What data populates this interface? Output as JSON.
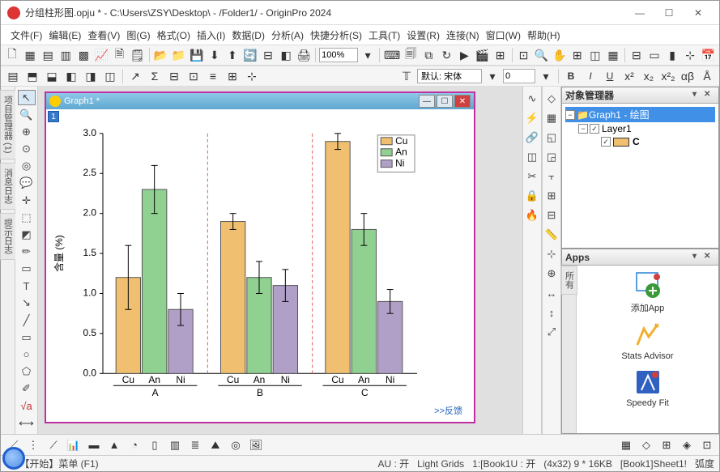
{
  "title": "分组柱形图.opju * - C:\\Users\\ZSY\\Desktop\\ - /Folder1/ - OriginPro 2024",
  "menu": {
    "file": "文件(F)",
    "edit": "编辑(E)",
    "view": "查看(V)",
    "graph": "图(G)",
    "format": "格式(O)",
    "insert": "插入(I)",
    "data": "数据(D)",
    "analysis": "分析(A)",
    "gadgets": "快捷分析(S)",
    "tools": "工具(T)",
    "settings": "设置(R)",
    "connect": "连接(N)",
    "window": "窗口(W)",
    "help": "帮助(H)"
  },
  "zoom": "100%",
  "font_hint": "默认: 宋体",
  "font_size": "0",
  "childwin": {
    "title": "Graph1 *",
    "layer": "1"
  },
  "feedback": ">>反馈",
  "objmgr": {
    "title": "对象管理器",
    "root": "Graph1 - 绘图",
    "layer": "Layer1",
    "series": "C"
  },
  "apps": {
    "title": "Apps",
    "dock": "所有",
    "items": [
      {
        "label": "添加App"
      },
      {
        "label": "Stats Advisor"
      },
      {
        "label": "Speedy Fit"
      }
    ]
  },
  "status": {
    "left": "<< 【开始】菜单 (F1)",
    "au": "AU : 开",
    "lg": "Light Grids",
    "book": "1:[Book1U : 开",
    "dim": "(4x32) 9 * 16KB",
    "sheet": "[Book1]Sheet1!",
    "ang": "弧度"
  },
  "chart_data": {
    "type": "bar",
    "ylabel": "含量 (%)",
    "ylim": [
      0.0,
      3.0
    ],
    "yticks": [
      0.0,
      0.5,
      1.0,
      1.5,
      2.0,
      2.5,
      3.0
    ],
    "groups": [
      "A",
      "B",
      "C"
    ],
    "categories": [
      "Cu",
      "An",
      "Ni"
    ],
    "series": [
      {
        "name": "Cu",
        "color": "#f0c070",
        "values": {
          "A": 1.2,
          "B": 1.9,
          "C": 2.9
        },
        "err": {
          "A": 0.4,
          "B": 0.1,
          "C": 0.1
        }
      },
      {
        "name": "An",
        "color": "#90d090",
        "values": {
          "A": 2.3,
          "B": 1.2,
          "C": 1.8
        },
        "err": {
          "A": 0.3,
          "B": 0.2,
          "C": 0.2
        }
      },
      {
        "name": "Ni",
        "color": "#b0a0c8",
        "values": {
          "A": 0.8,
          "B": 1.1,
          "C": 0.9
        },
        "err": {
          "A": 0.2,
          "B": 0.2,
          "C": 0.15
        }
      }
    ]
  }
}
